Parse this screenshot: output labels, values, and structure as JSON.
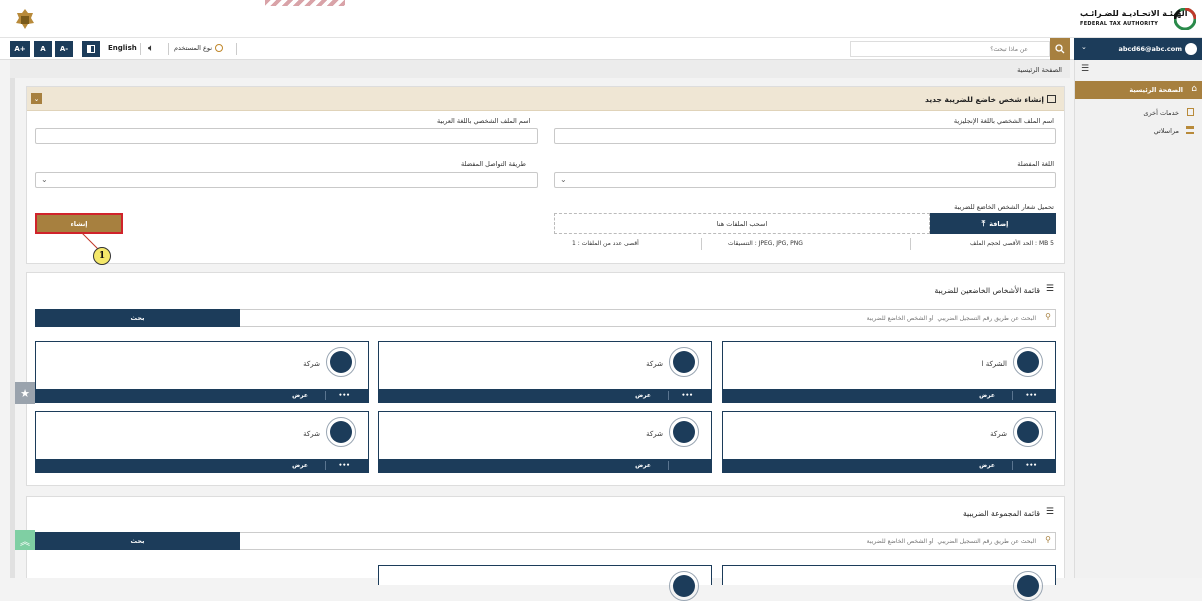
{
  "header": {
    "org_name_ar": "الهيئـة الاتحـاديـة للضـرائـب",
    "org_name_en": "FEDERAL TAX AUTHORITY"
  },
  "toolbar": {
    "font_increase": "A+",
    "font_reset": "A",
    "font_decrease": "A-",
    "language": "English",
    "user_type": "نوع المستخدم",
    "search_placeholder": "عن ماذا تبحث؟",
    "user_email": "abcd66@abc.com"
  },
  "breadcrumb": {
    "home": "الصفحة الرئيسية"
  },
  "sidebar": {
    "items": [
      {
        "label": "الصفحة الرئيسية",
        "active": true
      },
      {
        "label": "خدمات أخرى",
        "active": false
      },
      {
        "label": "مراسلاتي",
        "active": false
      }
    ]
  },
  "create_form": {
    "title": "إنشاء شخص خاضع للضريبة جديد",
    "name_en_label": "اسم الملف الشخصي باللغة الإنجليزية",
    "name_ar_label": "اسم الملف الشخصي باللغة العربية",
    "language_label": "اللغة المفضلة",
    "contact_label": "طريقة التواصل المفضلة",
    "logo_label": "تحميل شعار الشخص الخاضع للضريبة",
    "add_label": "إضافة",
    "drop_label": "اسحب الملفات هنا",
    "create_label": "إنشاء",
    "max_size": "الحد الأقصى لحجم الملف : MB 5",
    "formats": "التنسيقات : JPEG, JPG, PNG",
    "max_files": "أقصى عدد من الملفات : 1",
    "marker": "1"
  },
  "taxable_list": {
    "title": "قائمة الأشخاص الخاضعين للضريبة",
    "search_placeholder": "البحث عن طريق رقم التسجيل الضريبي  أو الشخص الخاضع للضريبة",
    "search_button": "بحث",
    "cards": [
      {
        "name": "الشركة ا"
      },
      {
        "name": "شركة"
      },
      {
        "name": "شركة"
      },
      {
        "name": "شركة"
      },
      {
        "name": "شركة"
      },
      {
        "name": "شركة"
      }
    ],
    "view_label": "عرض",
    "more_label": "•••"
  },
  "group_list": {
    "title": "قائمة المجموعة الضريبية",
    "search_placeholder": "البحث عن طريق رقم التسجيل الضريبي  أو الشخص الخاضع للضريبة",
    "search_button": "بحث"
  }
}
